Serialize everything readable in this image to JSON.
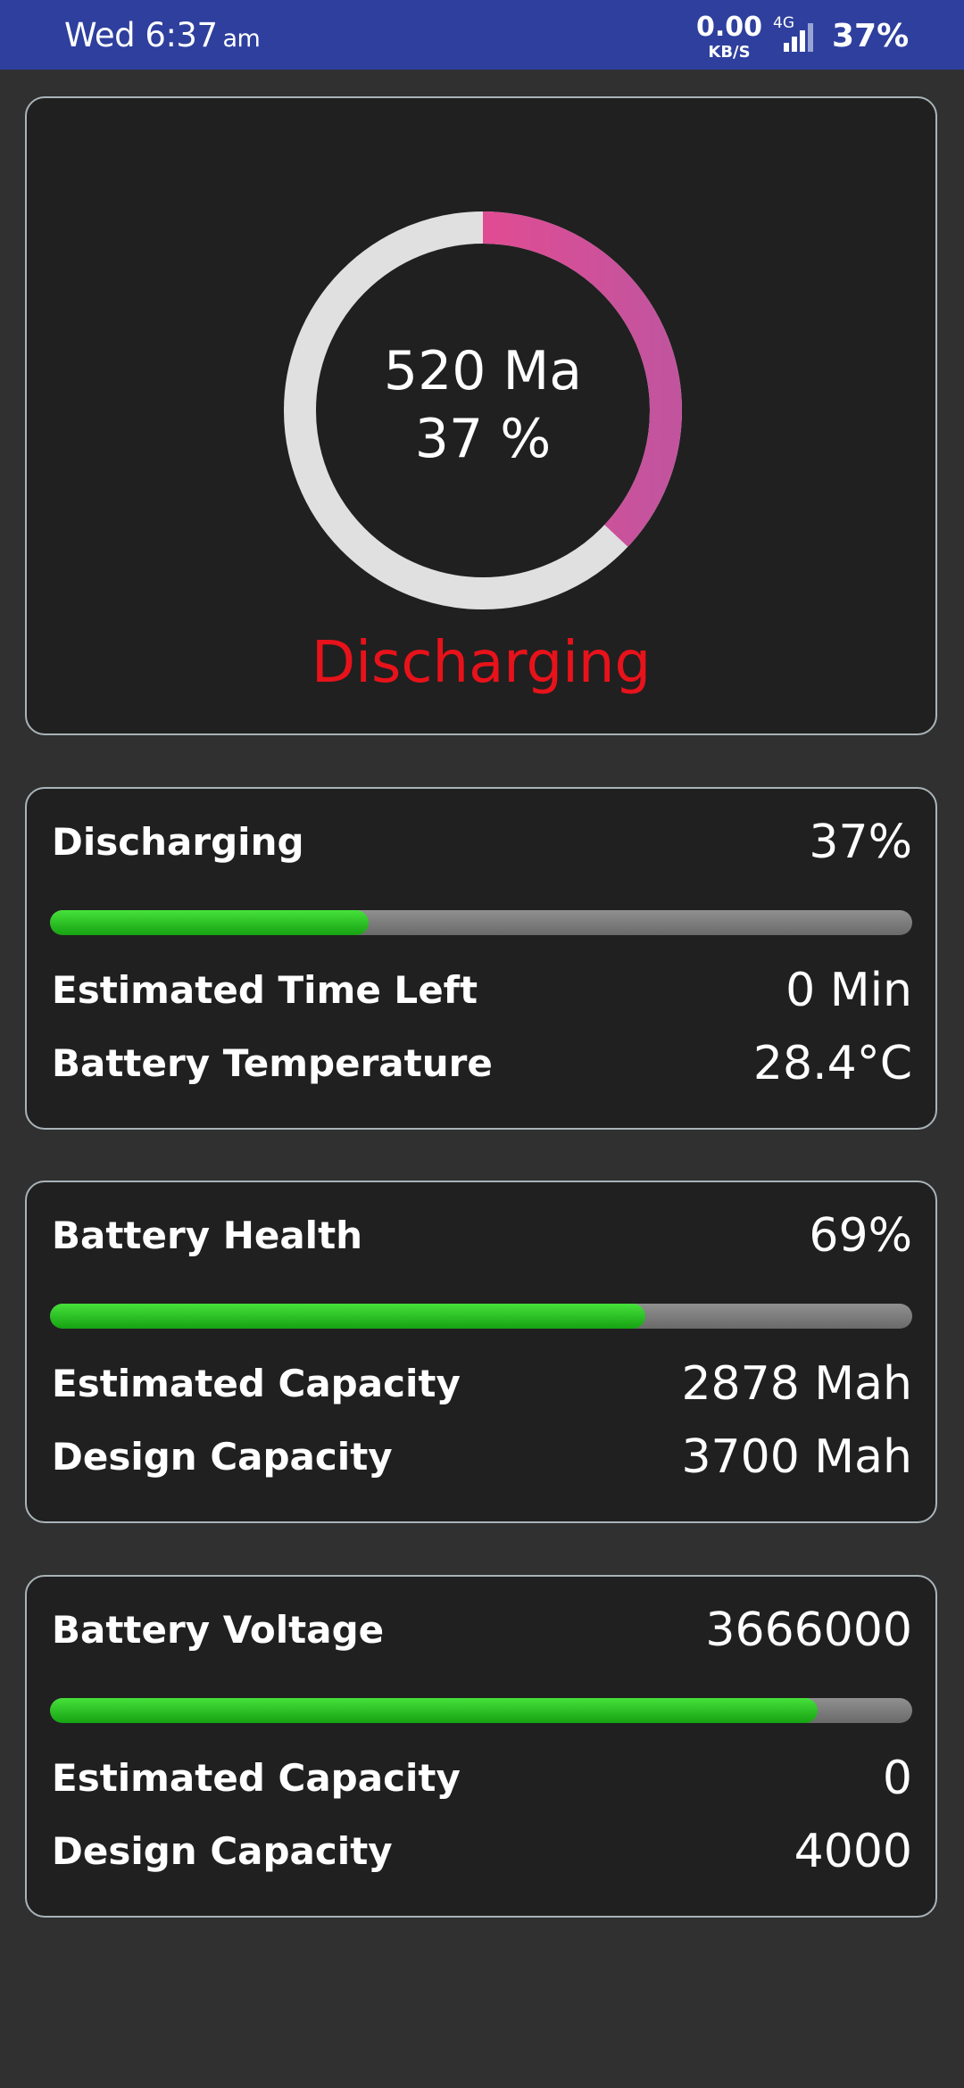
{
  "status_bar": {
    "time": "Wed 6:37",
    "ampm": "am",
    "net_speed": "0.00",
    "net_speed_unit": "KB/S",
    "network_type": "4G",
    "battery_percent": "37%",
    "background_color": "#2e3f9e"
  },
  "gauge": {
    "current": "520 Ma",
    "percent": "37 %",
    "level": 0.37,
    "status": "Discharging",
    "status_color": "#e8121a",
    "track_color": "#e0e0e0",
    "arc_colors": [
      "#ff4488",
      "#c2549e"
    ]
  },
  "discharge_card": {
    "title": "Discharging",
    "value": "37%",
    "level": 0.37,
    "rows": [
      {
        "label": "Estimated Time Left",
        "value": "0 Min"
      },
      {
        "label": "Battery Temperature",
        "value": "28.4°C"
      }
    ]
  },
  "health_card": {
    "title": "Battery Health",
    "value": "69%",
    "level": 0.69,
    "rows": [
      {
        "label": "Estimated Capacity",
        "value": "2878 Mah"
      },
      {
        "label": "Design Capacity",
        "value": "3700 Mah"
      }
    ]
  },
  "voltage_card": {
    "title": "Battery Voltage",
    "value": "3666000",
    "level": 0.89,
    "rows": [
      {
        "label": "Estimated Capacity",
        "value": "0"
      },
      {
        "label": "Design Capacity",
        "value": "4000"
      }
    ]
  },
  "colors": {
    "background": "#303030",
    "card": "#202020",
    "card_border": "#a9b3b8",
    "progress_fill": "#22c11a",
    "progress_track": "#7a7a7a"
  }
}
